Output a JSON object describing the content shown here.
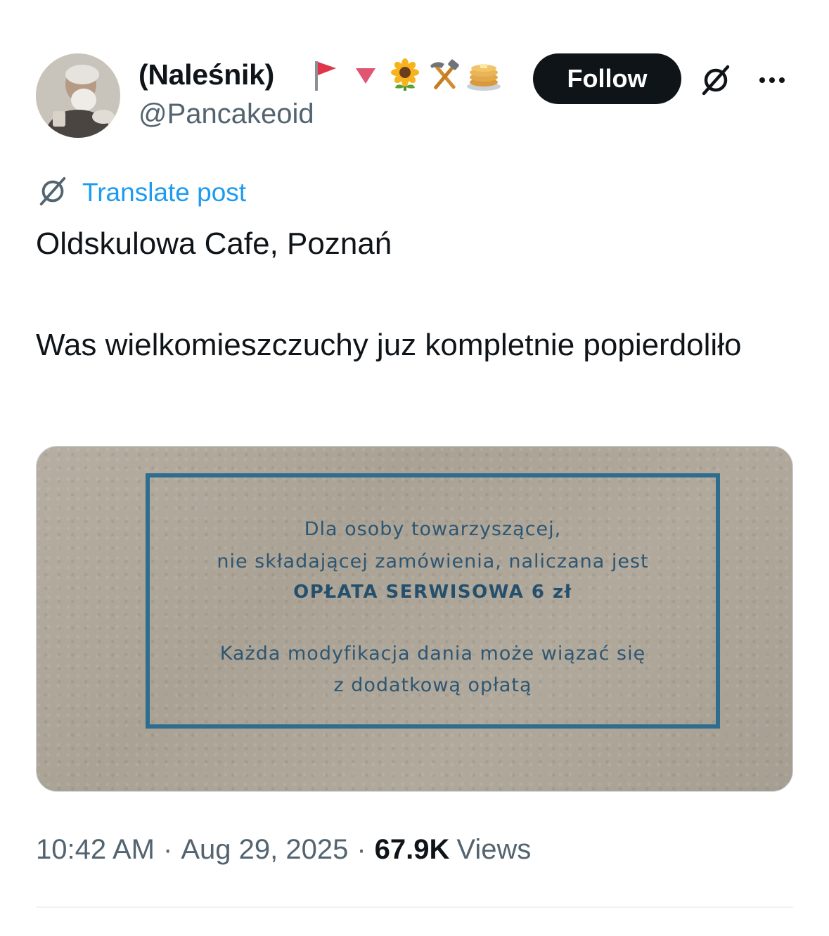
{
  "author": {
    "display_name": "(Naleśnik)",
    "handle": "@Pancakeoid",
    "name_emojis": [
      "red-flag-icon",
      "red-triangle-down-icon",
      "sunflower-icon",
      "hammer-and-pick-icon",
      "pancakes-icon"
    ]
  },
  "header": {
    "follow_label": "Follow"
  },
  "translate": {
    "label": "Translate post"
  },
  "tweet": {
    "line1": "Oldskulowa Cafe, Poznań",
    "line2": "Was wielkomieszczuchy juz kompletnie popierdoliło"
  },
  "media": {
    "lines": [
      "Dla osoby towarzyszącej,",
      "nie składającej zamówienia, naliczana jest",
      "OPŁATA SERWISOWA 6 zł",
      "Każda modyfikacja dania może wiązać się",
      "z dodatkową opłatą"
    ]
  },
  "meta": {
    "time": "10:42 AM",
    "separator": "·",
    "date": "Aug 29, 2025",
    "views_count": "67.9K",
    "views_label": "Views"
  },
  "colors": {
    "link": "#1d9bf0",
    "secondary_text": "#536471",
    "primary_text": "#0f1419",
    "notice_ink": "#2f6d8f"
  }
}
